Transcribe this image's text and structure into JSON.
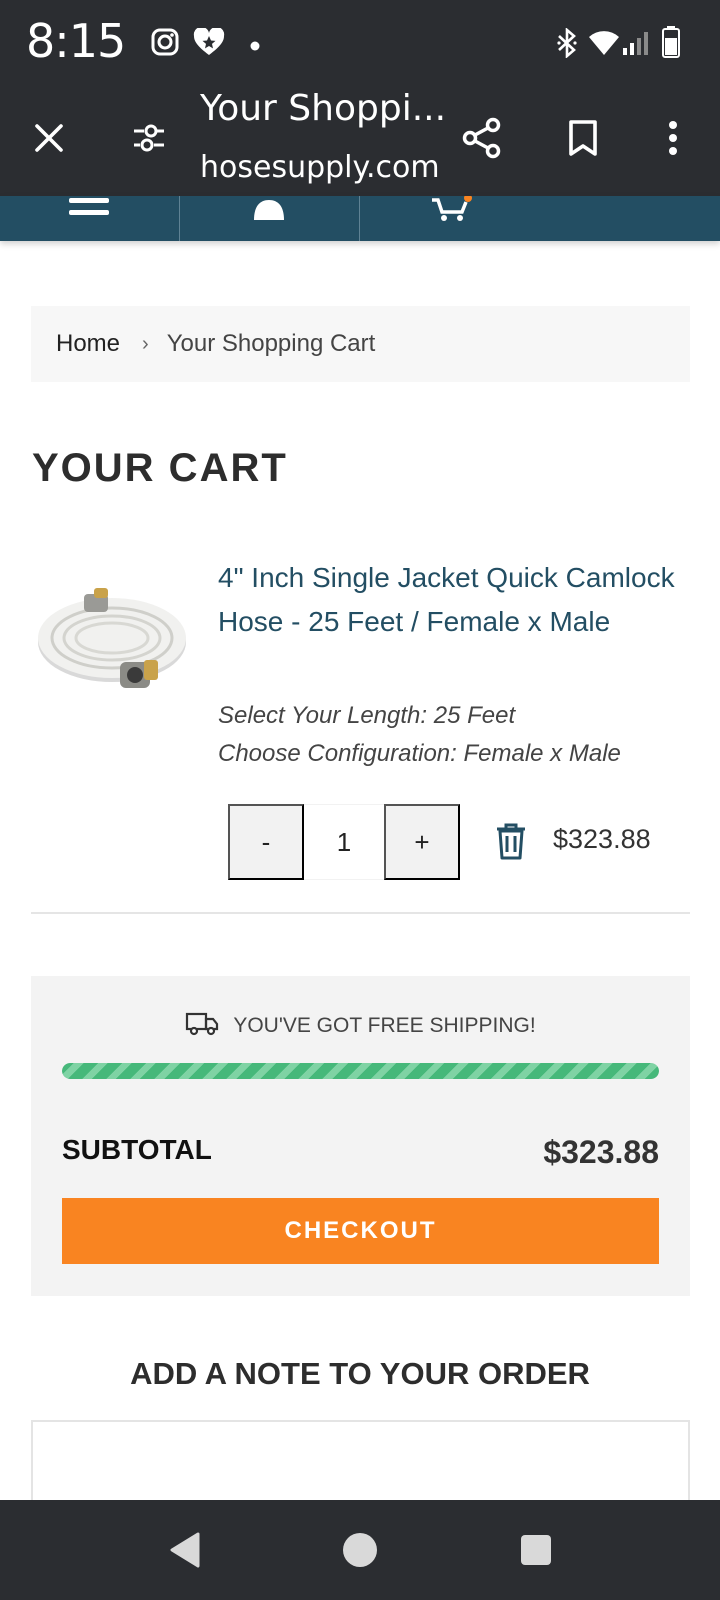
{
  "status_bar": {
    "time": "8:15",
    "icons": [
      "instagram-icon",
      "heart-badge-icon",
      "dot-icon",
      "bluetooth-icon",
      "wifi-icon",
      "signal-icon",
      "battery-icon"
    ]
  },
  "toolbar": {
    "title": "Your Shoppi...",
    "url": "hosesupply.com",
    "icons": [
      "close-icon",
      "tune-icon",
      "share-icon",
      "bookmark-icon",
      "more-vert-icon"
    ]
  },
  "site_nav": {
    "icons": [
      "menu-icon",
      "account-icon",
      "cart-icon"
    ]
  },
  "breadcrumb": {
    "home": "Home",
    "separator": "›",
    "current": "Your Shopping Cart"
  },
  "page_title": "YOUR CART",
  "cart_item": {
    "name": "4\" Inch Single Jacket Quick Camlock Hose - 25 Feet / Female x Male",
    "variant_length": "Select Your Length: 25 Feet",
    "variant_config": "Choose Configuration: Female x Male",
    "qty_minus": "-",
    "quantity": "1",
    "qty_plus": "+",
    "price": "$323.88"
  },
  "summary": {
    "shipping_message": "YOU'VE GOT FREE SHIPPING!",
    "shipping_progress": 1.0,
    "subtotal_label": "SUBTOTAL",
    "subtotal_value": "$323.88",
    "checkout_label": "CHECKOUT"
  },
  "note": {
    "heading": "ADD A NOTE TO YOUR ORDER",
    "value": ""
  },
  "colors": {
    "accent_navy": "#234e63",
    "checkout_orange": "#f98421",
    "progress_green": "#46b87a",
    "system_bar": "#2b2d31"
  }
}
